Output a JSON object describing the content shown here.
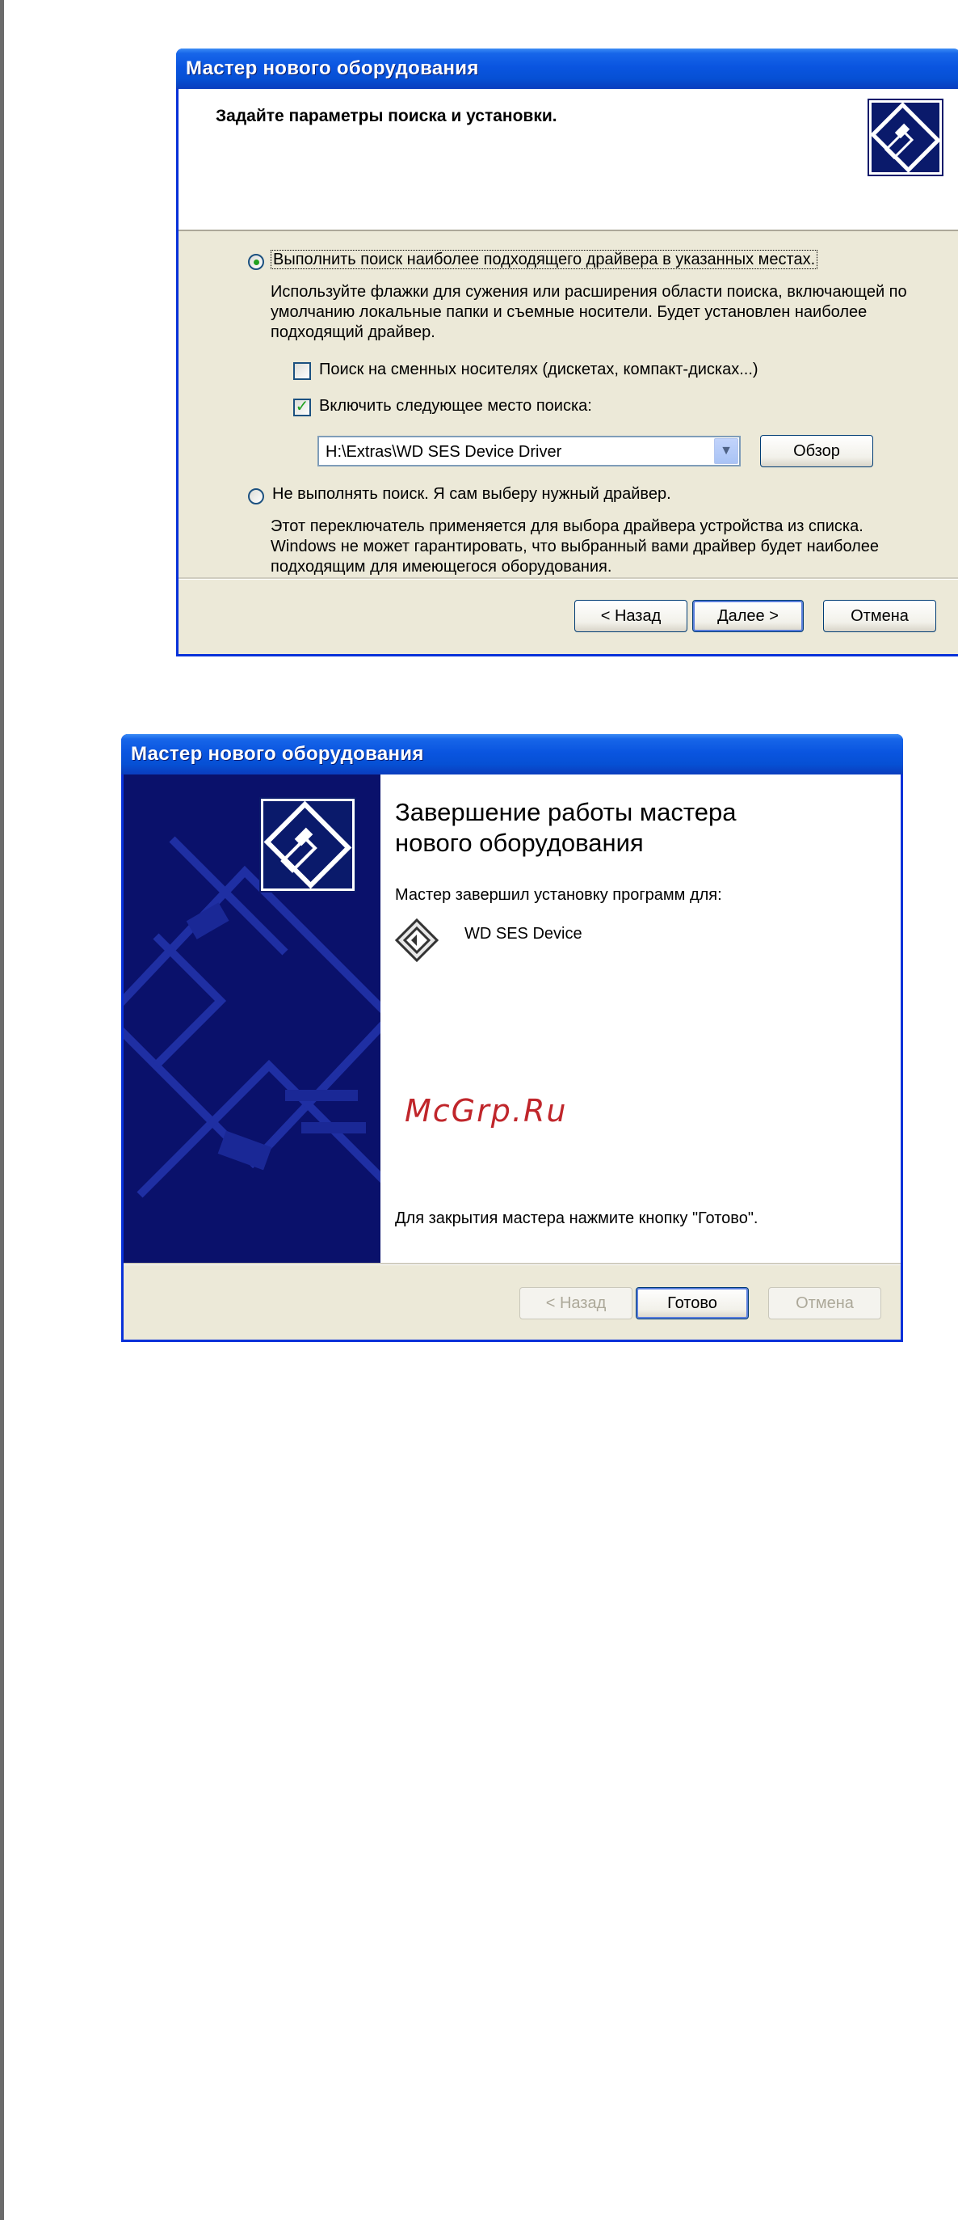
{
  "dialog1": {
    "title": "Мастер нового оборудования",
    "header": "Задайте параметры поиска и установки.",
    "option_search": {
      "label": "Выполнить поиск наиболее подходящего драйвера в указанных местах.",
      "selected": true,
      "description": "Используйте флажки для сужения или расширения области поиска, включающей по умолчанию локальные папки и съемные носители. Будет установлен наиболее подходящий драйвер."
    },
    "check_removable": {
      "label": "Поиск на сменных носителях (дискетах, компакт-дисках...)",
      "checked": false
    },
    "check_include": {
      "label": "Включить следующее место поиска:",
      "checked": true
    },
    "path_combo": {
      "value": "H:\\Extras\\WD SES Device Driver"
    },
    "browse_label": "Обзор",
    "option_manual": {
      "label": "Не выполнять поиск. Я сам выберу нужный драйвер.",
      "selected": false,
      "description": "Этот переключатель применяется для выбора драйвера устройства из списка. Windows не может гарантировать, что выбранный вами драйвер будет наиболее подходящим для имеющегося оборудования."
    },
    "buttons": {
      "back": "< Назад",
      "next": "Далее >",
      "cancel": "Отмена"
    }
  },
  "dialog2": {
    "title": "Мастер нового оборудования",
    "heading_line1": "Завершение работы мастера",
    "heading_line2": "нового оборудования",
    "installed_text": "Мастер завершил установку программ для:",
    "device_name": "WD SES Device",
    "watermark": "McGrp.Ru",
    "finish_text": "Для закрытия мастера нажмите кнопку \"Готово\".",
    "buttons": {
      "back": "< Назад",
      "finish": "Готово",
      "cancel": "Отмена"
    }
  },
  "colors": {
    "titlebar": "#0a55e0",
    "dialog_bg": "#ece9d8",
    "sidebar": "#0a116b",
    "watermark": "#c0262b"
  }
}
